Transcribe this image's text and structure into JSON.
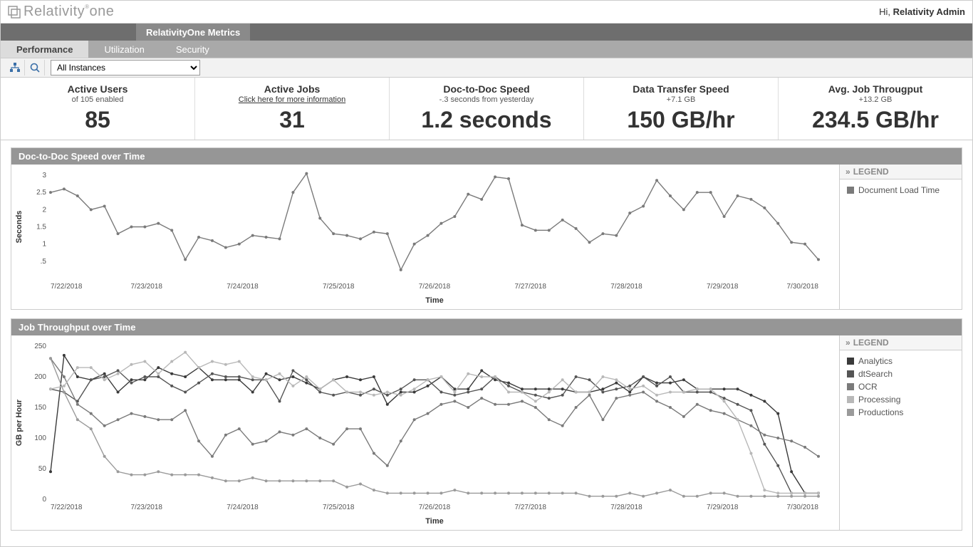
{
  "header": {
    "logo_text": "Relativity one",
    "greeting_prefix": "Hi, ",
    "greeting_user": "Relativity Admin"
  },
  "nav1": {
    "active_tab": "RelativityOne Metrics"
  },
  "nav2": {
    "items": [
      "Performance",
      "Utilization",
      "Security"
    ],
    "active_index": 0
  },
  "toolbar": {
    "instance_selected": "All Instances"
  },
  "kpis": [
    {
      "title": "Active Users",
      "sub": "of 105 enabled",
      "value": "85"
    },
    {
      "title": "Active Jobs",
      "link": "Click here for more information",
      "value": "31"
    },
    {
      "title": "Doc-to-Doc Speed",
      "sub": "-.3 seconds from yesterday",
      "value": "1.2 seconds"
    },
    {
      "title": "Data Transfer Speed",
      "sub": "+7.1 GB",
      "value": "150 GB/hr"
    },
    {
      "title": "Avg. Job Througput",
      "sub": "+13.2 GB",
      "value": "234.5 GB/hr"
    }
  ],
  "legend_label": "LEGEND",
  "chart1": {
    "title": "Doc-to-Doc Speed over Time",
    "xlabel": "Time",
    "ylabel": "Seconds",
    "legend": [
      {
        "name": "Document Load Time",
        "color": "#7a7a7a"
      }
    ]
  },
  "chart2": {
    "title": "Job Throughput over Time",
    "xlabel": "Time",
    "ylabel": "GB per Hour",
    "legend": [
      {
        "name": "Analytics",
        "color": "#3a3a3a"
      },
      {
        "name": "dtSearch",
        "color": "#555555"
      },
      {
        "name": "OCR",
        "color": "#7a7a7a"
      },
      {
        "name": "Processing",
        "color": "#b8b8b8"
      },
      {
        "name": "Productions",
        "color": "#9a9a9a"
      }
    ]
  },
  "chart_data": [
    {
      "type": "line",
      "title": "Doc-to-Doc Speed over Time",
      "xlabel": "Time",
      "ylabel": "Seconds",
      "ylim": [
        0,
        3.0
      ],
      "yticks": [
        0.5,
        1.0,
        1.5,
        2.0,
        2.5,
        3.0
      ],
      "xticks": [
        "7/22/2018",
        "7/23/2018",
        "7/24/2018",
        "7/25/2018",
        "7/26/2018",
        "7/27/2018",
        "7/28/2018",
        "7/29/2018",
        "7/30/2018"
      ],
      "series": [
        {
          "name": "Document Load Time",
          "values": [
            2.5,
            2.6,
            2.4,
            2.0,
            2.1,
            1.3,
            1.5,
            1.5,
            1.6,
            1.4,
            0.55,
            1.2,
            1.1,
            0.9,
            1.0,
            1.25,
            1.2,
            1.15,
            2.5,
            3.05,
            1.75,
            1.3,
            1.25,
            1.15,
            1.35,
            1.3,
            0.25,
            1.0,
            1.25,
            1.6,
            1.8,
            2.45,
            2.3,
            2.95,
            2.9,
            1.55,
            1.4,
            1.4,
            1.7,
            1.45,
            1.05,
            1.3,
            1.25,
            1.9,
            2.1,
            2.85,
            2.4,
            2.0,
            2.5,
            2.5,
            1.8,
            2.4,
            2.3,
            2.05,
            1.6,
            1.05,
            1.0,
            0.55
          ]
        }
      ]
    },
    {
      "type": "line",
      "title": "Job Throughput over Time",
      "xlabel": "Time",
      "ylabel": "GB per Hour",
      "ylim": [
        0,
        250
      ],
      "yticks": [
        0,
        50,
        100,
        150,
        200,
        250
      ],
      "xticks": [
        "7/22/2018",
        "7/23/2018",
        "7/24/2018",
        "7/25/2018",
        "7/26/2018",
        "7/27/2018",
        "7/28/2018",
        "7/29/2018",
        "7/30/2018"
      ],
      "series": [
        {
          "name": "Analytics",
          "values": [
            45,
            235,
            200,
            195,
            205,
            175,
            195,
            195,
            215,
            205,
            200,
            215,
            195,
            195,
            195,
            175,
            205,
            195,
            200,
            190,
            180,
            195,
            200,
            195,
            200,
            155,
            175,
            175,
            185,
            200,
            180,
            180,
            210,
            195,
            190,
            180,
            180,
            180,
            180,
            175,
            175,
            180,
            190,
            175,
            200,
            190,
            190,
            195,
            180,
            180,
            180,
            180,
            170,
            160,
            140,
            45,
            10,
            10
          ]
        },
        {
          "name": "dtSearch",
          "values": [
            180,
            175,
            160,
            195,
            200,
            210,
            190,
            200,
            200,
            185,
            175,
            190,
            205,
            200,
            200,
            195,
            195,
            160,
            210,
            195,
            175,
            170,
            175,
            170,
            180,
            170,
            180,
            195,
            195,
            175,
            170,
            175,
            180,
            200,
            185,
            175,
            170,
            165,
            170,
            200,
            195,
            175,
            180,
            185,
            200,
            185,
            200,
            175,
            175,
            175,
            165,
            155,
            145,
            90,
            55,
            10,
            10,
            10
          ]
        },
        {
          "name": "OCR",
          "values": [
            230,
            200,
            155,
            140,
            120,
            130,
            140,
            135,
            130,
            130,
            145,
            95,
            70,
            105,
            115,
            90,
            95,
            110,
            105,
            115,
            100,
            90,
            115,
            115,
            75,
            55,
            95,
            130,
            140,
            155,
            160,
            150,
            165,
            155,
            155,
            160,
            150,
            130,
            120,
            150,
            170,
            130,
            165,
            170,
            175,
            160,
            150,
            135,
            155,
            145,
            140,
            130,
            120,
            105,
            100,
            95,
            85,
            70
          ]
        },
        {
          "name": "Processing",
          "values": [
            180,
            185,
            215,
            215,
            195,
            205,
            220,
            225,
            205,
            225,
            240,
            215,
            225,
            220,
            225,
            200,
            195,
            205,
            185,
            200,
            180,
            195,
            175,
            175,
            170,
            175,
            170,
            180,
            195,
            200,
            175,
            205,
            200,
            200,
            175,
            175,
            160,
            175,
            195,
            175,
            175,
            200,
            195,
            180,
            185,
            170,
            175,
            175,
            180,
            180,
            160,
            130,
            75,
            15,
            10,
            10,
            10,
            10
          ]
        },
        {
          "name": "Productions",
          "values": [
            230,
            175,
            130,
            115,
            70,
            45,
            40,
            40,
            45,
            40,
            40,
            40,
            35,
            30,
            30,
            35,
            30,
            30,
            30,
            30,
            30,
            30,
            20,
            25,
            15,
            10,
            10,
            10,
            10,
            10,
            15,
            10,
            10,
            10,
            10,
            10,
            10,
            10,
            10,
            10,
            5,
            5,
            5,
            10,
            5,
            10,
            15,
            5,
            5,
            10,
            10,
            5,
            5,
            5,
            5,
            5,
            5,
            5
          ]
        }
      ]
    }
  ]
}
